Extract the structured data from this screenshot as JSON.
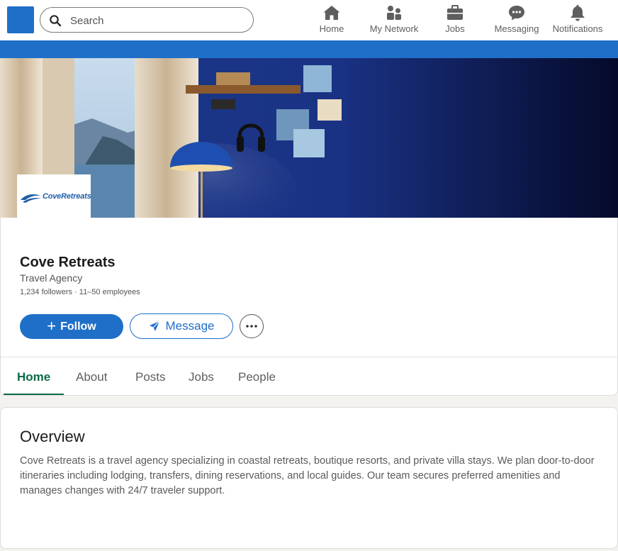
{
  "nav": {
    "search_placeholder": "Search",
    "items": [
      {
        "label": "Home",
        "icon": "home-icon"
      },
      {
        "label": "My Network",
        "icon": "people-icon"
      },
      {
        "label": "Jobs",
        "icon": "briefcase-icon"
      },
      {
        "label": "Messaging",
        "icon": "chat-icon"
      },
      {
        "label": "Notifications",
        "icon": "bell-icon"
      }
    ]
  },
  "company": {
    "logo_text": "CoveRetreats",
    "name": "Cove Retreats",
    "type": "Travel Agency",
    "meta": "1,234 followers · 11–50 employees"
  },
  "actions": {
    "follow_label": "Follow",
    "message_label": "Message"
  },
  "tabs": [
    {
      "label": "Home",
      "active": true
    },
    {
      "label": "About",
      "active": false
    },
    {
      "label": "Posts",
      "active": false
    },
    {
      "label": "Jobs",
      "active": false
    },
    {
      "label": "People",
      "active": false
    }
  ],
  "overview": {
    "title": "Overview",
    "text": "Cove Retreats is a travel agency specializing in coastal retreats, boutique resorts, and private villa stays. We plan door-to-door itineraries including lodging, transfers, dining reservations, and local guides. Our team secures preferred amenities and manages changes with 24/7 traveler support."
  },
  "colors": {
    "brand_blue": "#1f6fc8",
    "active_tab": "#0b6b45"
  }
}
